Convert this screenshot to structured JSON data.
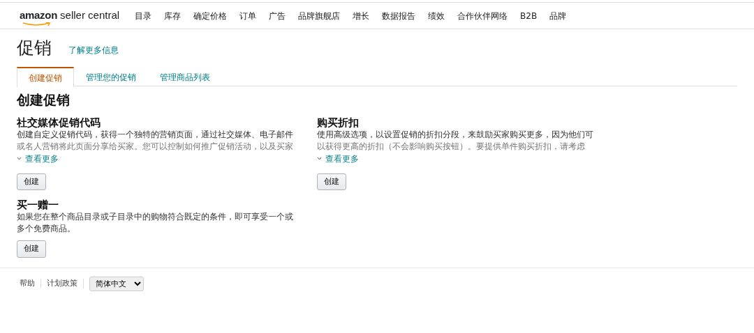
{
  "logo": {
    "brand": "amazon",
    "product": "seller central"
  },
  "nav": [
    "目录",
    "库存",
    "确定价格",
    "订单",
    "广告",
    "品牌旗舰店",
    "增长",
    "数据报告",
    "绩效",
    "合作伙伴网络",
    "B2B",
    "品牌"
  ],
  "page": {
    "title": "促销",
    "learn_more": "了解更多信息"
  },
  "tabs": [
    {
      "label": "创建促销",
      "selected": true
    },
    {
      "label": "管理您的促销",
      "selected": false
    },
    {
      "label": "管理商品列表",
      "selected": false
    }
  ],
  "section_title": "创建促销",
  "promotions": [
    {
      "title": "社交媒体促销代码",
      "lines": [
        "创建自定义促销代码，获得一个独特的营销页面，通过社交媒体、电子邮件",
        "或名人营销将此页面分享给买家。您可以控制如何推广促销活动，以及买家"
      ],
      "more": {
        "label": "查看更多",
        "expanded": false
      },
      "button": "创建"
    },
    {
      "title": "购买折扣",
      "lines": [
        "使用高级选项，以设置促销的折扣分段，来鼓励买家购买更多，因为他们可",
        "以获得更高的折扣（不会影响购买按钮）。要提供单件购买折扣，请考虑"
      ],
      "more": {
        "label": "查看更多",
        "expanded": false
      },
      "button": "创建"
    },
    {
      "title": "买一赠一",
      "lines": [
        "如果您在整个商品目录或子目录中的购物符合既定的条件，即可享受一个或",
        "多个免费商品。"
      ],
      "button": "创建"
    }
  ],
  "footer": {
    "links": [
      "帮助",
      "计划政策"
    ],
    "language": "简体中文"
  }
}
